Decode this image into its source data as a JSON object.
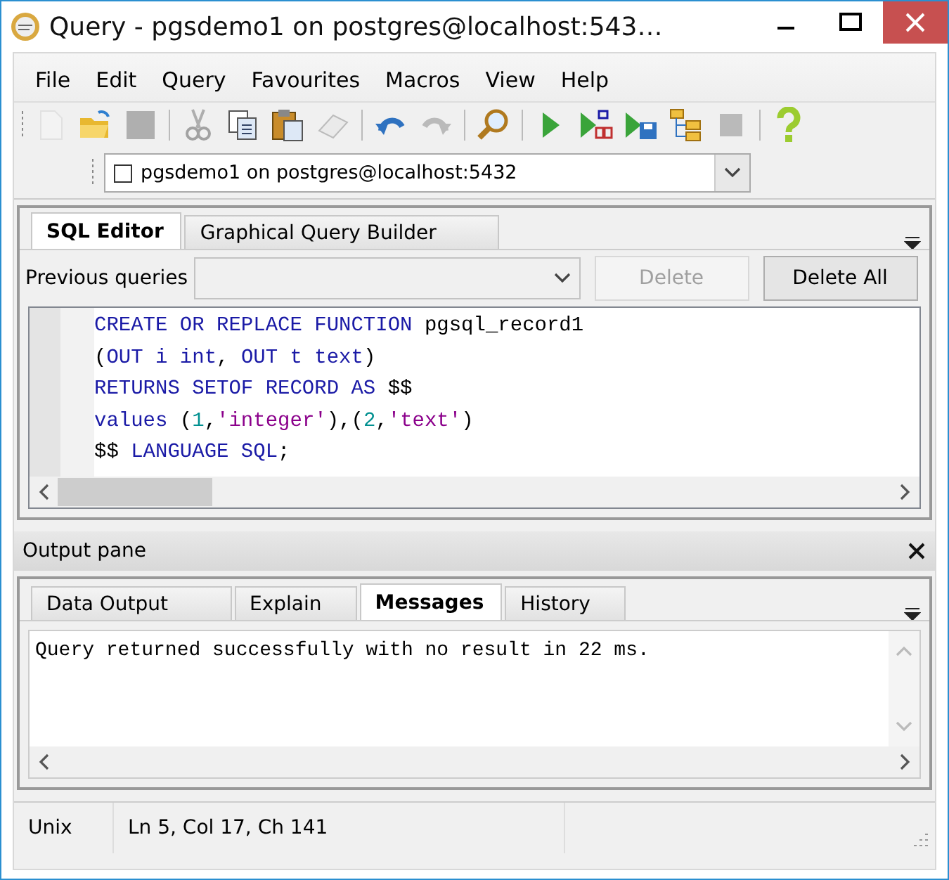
{
  "window": {
    "title": "Query - pgsdemo1 on postgres@localhost:543…"
  },
  "menu": [
    "File",
    "Edit",
    "Query",
    "Favourites",
    "Macros",
    "View",
    "Help"
  ],
  "toolbar": [
    {
      "kind": "new",
      "disabled": true
    },
    {
      "kind": "open",
      "disabled": false
    },
    {
      "kind": "save",
      "disabled": true
    },
    {
      "kind": "separator"
    },
    {
      "kind": "cut",
      "disabled": true
    },
    {
      "kind": "copy",
      "disabled": false
    },
    {
      "kind": "paste",
      "disabled": false
    },
    {
      "kind": "clear",
      "disabled": true
    },
    {
      "kind": "separator"
    },
    {
      "kind": "undo",
      "disabled": false
    },
    {
      "kind": "redo",
      "disabled": true
    },
    {
      "kind": "separator"
    },
    {
      "kind": "find",
      "disabled": false
    },
    {
      "kind": "separator"
    },
    {
      "kind": "execute",
      "disabled": false
    },
    {
      "kind": "execute-pgscript",
      "disabled": false
    },
    {
      "kind": "execute-file",
      "disabled": false
    },
    {
      "kind": "explain",
      "disabled": false
    },
    {
      "kind": "stop",
      "disabled": true
    },
    {
      "kind": "separator"
    },
    {
      "kind": "help",
      "disabled": false
    }
  ],
  "connection": {
    "value": "pgsdemo1 on postgres@localhost:5432"
  },
  "editor_tabs": [
    {
      "label": "SQL Editor",
      "selected": true
    },
    {
      "label": "Graphical Query Builder",
      "selected": false
    }
  ],
  "previous_queries": {
    "label": "Previous queries",
    "buttons": [
      {
        "label": "Delete",
        "disabled": true
      },
      {
        "label": "Delete All",
        "disabled": false
      }
    ]
  },
  "code": [
    [
      {
        "kind": "keyword",
        "text": "CREATE OR REPLACE FUNCTION "
      },
      {
        "kind": "plain",
        "text": "pgsql_record1"
      }
    ],
    [
      {
        "kind": "plain",
        "text": "("
      },
      {
        "kind": "keyword",
        "text": "OUT i int"
      },
      {
        "kind": "plain",
        "text": ", "
      },
      {
        "kind": "keyword",
        "text": "OUT t text"
      },
      {
        "kind": "plain",
        "text": ")"
      }
    ],
    [
      {
        "kind": "keyword",
        "text": "RETURNS SETOF RECORD AS "
      },
      {
        "kind": "plain",
        "text": "$$"
      }
    ],
    [
      {
        "kind": "keyword",
        "text": "values "
      },
      {
        "kind": "plain",
        "text": "("
      },
      {
        "kind": "number",
        "text": "1"
      },
      {
        "kind": "plain",
        "text": ","
      },
      {
        "kind": "string",
        "text": "'integer'"
      },
      {
        "kind": "plain",
        "text": "),("
      },
      {
        "kind": "number",
        "text": "2"
      },
      {
        "kind": "plain",
        "text": ","
      },
      {
        "kind": "string",
        "text": "'text'"
      },
      {
        "kind": "plain",
        "text": ")"
      }
    ],
    [
      {
        "kind": "plain",
        "text": "$$ "
      },
      {
        "kind": "keyword",
        "text": "LANGUAGE SQL"
      },
      {
        "kind": "plain",
        "text": ";"
      }
    ]
  ],
  "output_pane": {
    "title": "Output pane",
    "tabs": [
      {
        "label": "Data Output",
        "selected": false
      },
      {
        "label": "Explain",
        "selected": false
      },
      {
        "label": "Messages",
        "selected": true
      },
      {
        "label": "History",
        "selected": false
      }
    ],
    "message": "Query returned successfully with no result in 22 ms."
  },
  "status_bar": [
    "Unix",
    "Ln 5, Col 17, Ch 141"
  ]
}
